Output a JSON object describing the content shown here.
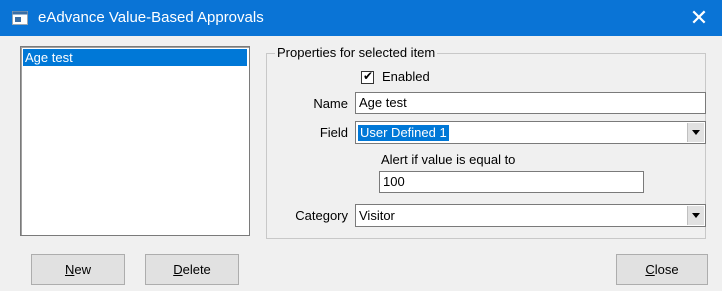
{
  "window": {
    "title": "eAdvance Value-Based Approvals",
    "close_glyph": "✕"
  },
  "list": {
    "items": [
      {
        "label": "Age test",
        "selected": true
      }
    ]
  },
  "properties": {
    "legend": "Properties for selected item",
    "enabled_label": "Enabled",
    "enabled_checked": true,
    "name_label": "Name",
    "name_value": "Age test",
    "field_label": "Field",
    "field_value": "User Defined 1",
    "alert_label": "Alert if value is equal to",
    "alert_value": "100",
    "category_label": "Category",
    "category_value": "Visitor"
  },
  "buttons": {
    "new": {
      "mnemonic": "N",
      "rest": "ew"
    },
    "delete": {
      "mnemonic": "D",
      "rest": "elete"
    },
    "close": {
      "mnemonic": "C",
      "rest": "lose"
    }
  },
  "colors": {
    "titlebar": "#0a74d6",
    "selection": "#0078d7",
    "face": "#f0f0f0"
  },
  "icons": {
    "app": "app-window-icon",
    "close": "close-icon",
    "dropdown": "chevron-down-icon",
    "check": "checkmark-icon"
  }
}
